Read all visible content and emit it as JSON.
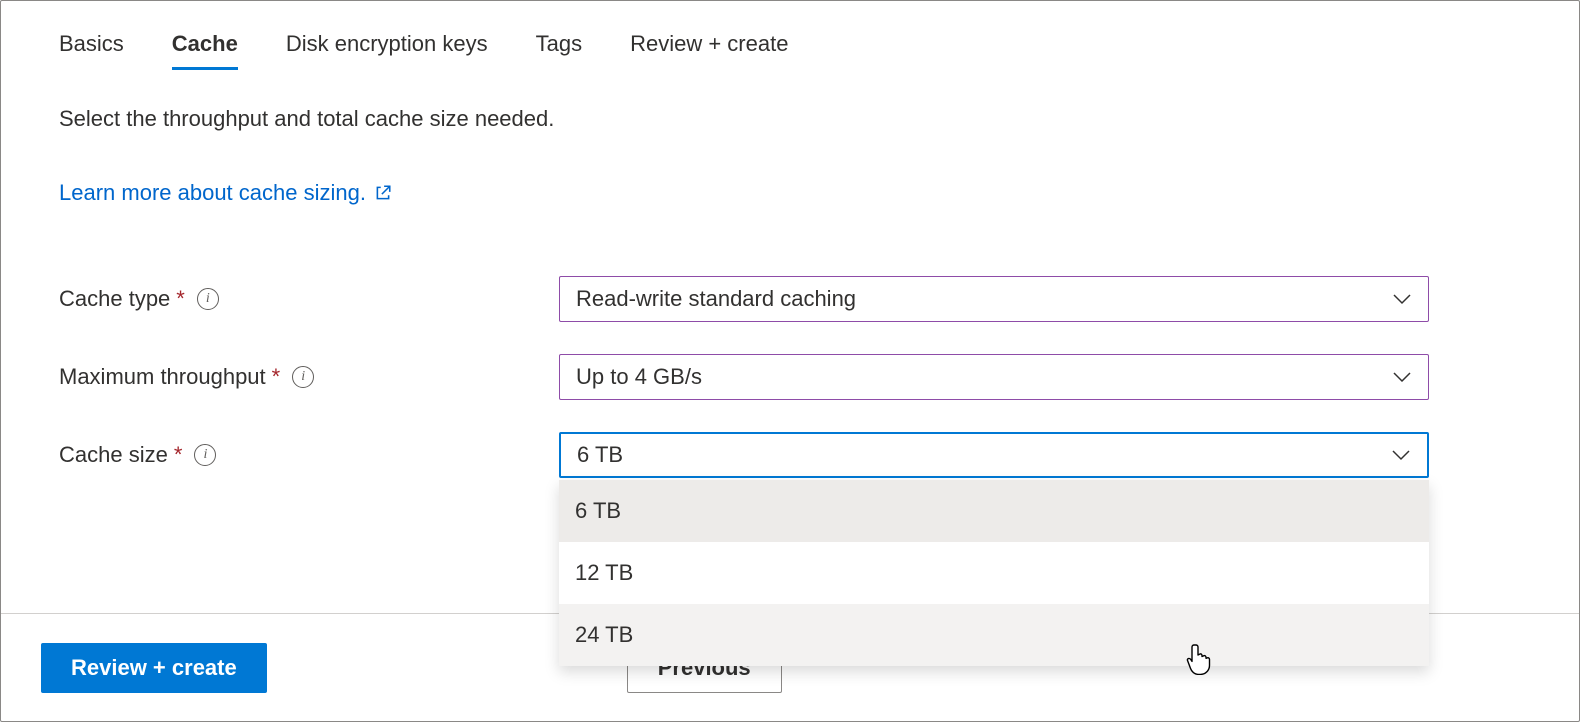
{
  "tabs": {
    "basics": "Basics",
    "cache": "Cache",
    "disk_encryption": "Disk encryption keys",
    "tags": "Tags",
    "review": "Review + create"
  },
  "description": "Select the throughput and total cache size needed.",
  "learn_more": "Learn more about cache sizing.",
  "fields": {
    "cache_type": {
      "label": "Cache type",
      "value": "Read-write standard caching"
    },
    "max_throughput": {
      "label": "Maximum throughput",
      "value": "Up to 4 GB/s"
    },
    "cache_size": {
      "label": "Cache size",
      "value": "6 TB",
      "options": [
        "6 TB",
        "12 TB",
        "24 TB"
      ]
    }
  },
  "buttons": {
    "review_create": "Review + create",
    "previous": "Previous"
  }
}
